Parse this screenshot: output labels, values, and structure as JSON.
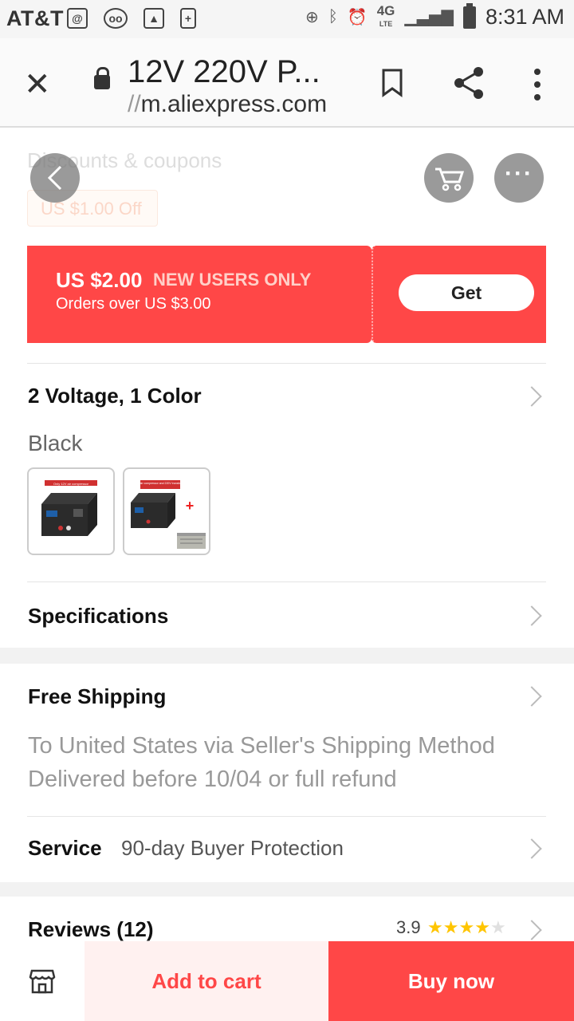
{
  "status_bar": {
    "carrier": "AT&T",
    "network": "4G",
    "network_sub": "LTE",
    "time": "8:31 AM"
  },
  "browser": {
    "page_title": "12V 220V P...",
    "url_prefix": "//",
    "url_host": "m.aliexpress.com"
  },
  "discounts": {
    "section_title": "Discounts & coupons",
    "chip_label": "US $1.00 Off"
  },
  "coupon": {
    "amount": "US $2.00",
    "tag": "NEW USERS ONLY",
    "condition": "Orders over US $3.00",
    "button_label": "Get"
  },
  "variants": {
    "title": "2 Voltage, 1 Color",
    "selected_color": "Black",
    "thumbnails": [
      {
        "caption": "Only 12V air compressor"
      },
      {
        "caption": "12V air compressor and 220V transformer"
      }
    ]
  },
  "specifications": {
    "title": "Specifications"
  },
  "shipping": {
    "title": "Free Shipping",
    "line1": "To United States via Seller's Shipping Method",
    "line2": "Delivered before 10/04 or full refund"
  },
  "service": {
    "label": "Service",
    "value": "90-day Buyer Protection"
  },
  "reviews": {
    "label": "Reviews (12)",
    "rating": "3.9",
    "stars_filled": 4,
    "stars_total": 5
  },
  "bottom_bar": {
    "add_to_cart": "Add to cart",
    "buy_now": "Buy now"
  },
  "colors": {
    "accent": "#ff4747",
    "add_cart_bg": "#fff1f0",
    "star": "#ffc500"
  }
}
